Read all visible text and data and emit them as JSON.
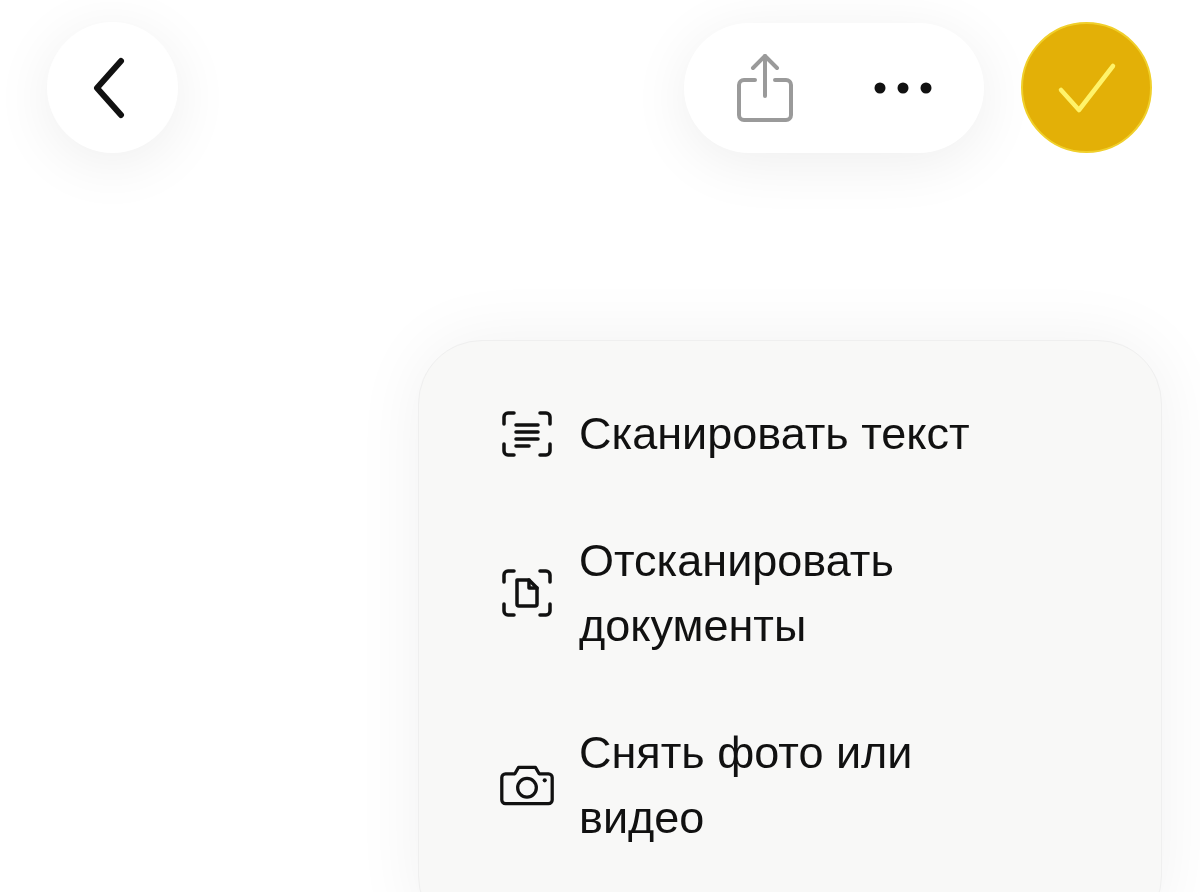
{
  "menu": {
    "items": [
      {
        "kind": "scan-text",
        "label": "Сканировать текст"
      },
      {
        "kind": "scan-document",
        "label": "Отсканировать документы"
      },
      {
        "kind": "camera",
        "label": "Снять фото или видео"
      }
    ]
  }
}
